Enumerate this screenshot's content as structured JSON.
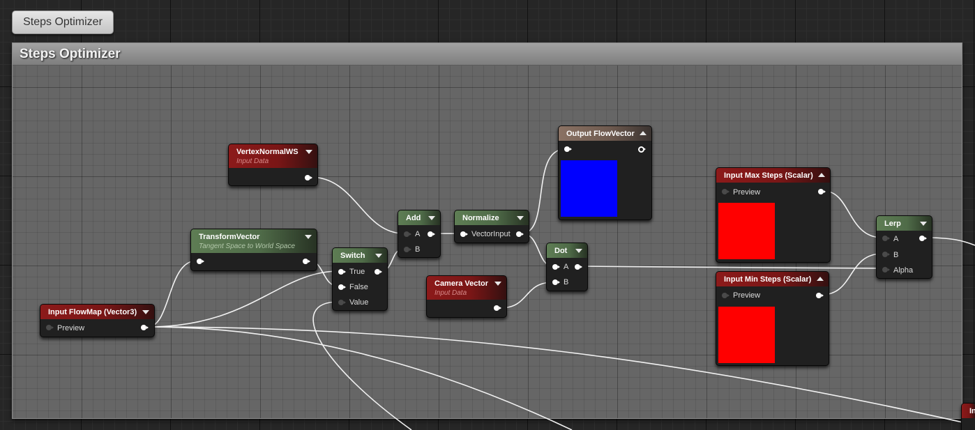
{
  "comment_bubble": {
    "label": "Steps Optimizer"
  },
  "comment_box": {
    "title": "Steps Optimizer",
    "color": "#666666"
  },
  "nodes": {
    "vertex_normal_ws": {
      "title": "VertexNormalWS",
      "subtitle": "Input Data"
    },
    "transform_vector": {
      "title": "TransformVector",
      "subtitle": "Tangent Space to World Space"
    },
    "input_flowmap": {
      "title": "Input FlowMap (Vector3)",
      "pins": [
        "Preview"
      ]
    },
    "switch": {
      "title": "Switch",
      "pins": [
        "True",
        "False",
        "Value"
      ]
    },
    "add": {
      "title": "Add",
      "pins": [
        "A",
        "B"
      ]
    },
    "normalize": {
      "title": "Normalize",
      "pins": [
        "VectorInput"
      ]
    },
    "output_flowvector": {
      "title": "Output FlowVector",
      "preview_color": "#0000ff"
    },
    "dot": {
      "title": "Dot",
      "pins": [
        "A",
        "B"
      ]
    },
    "camera_vector": {
      "title": "Camera Vector",
      "subtitle": "Input Data"
    },
    "input_max_steps": {
      "title": "Input Max Steps (Scalar)",
      "pins": [
        "Preview"
      ],
      "preview_color": "#ff0000"
    },
    "input_min_steps": {
      "title": "Input Min Steps (Scalar)",
      "pins": [
        "Preview"
      ],
      "preview_color": "#ff0000"
    },
    "lerp": {
      "title": "Lerp",
      "pins": [
        "A",
        "B",
        "Alpha"
      ]
    },
    "offscreen": {
      "title": "In"
    }
  },
  "icons": [
    "collapse-arrow-icon",
    "expand-arrow-icon",
    "pin-connected-icon",
    "pin-empty-icon"
  ]
}
